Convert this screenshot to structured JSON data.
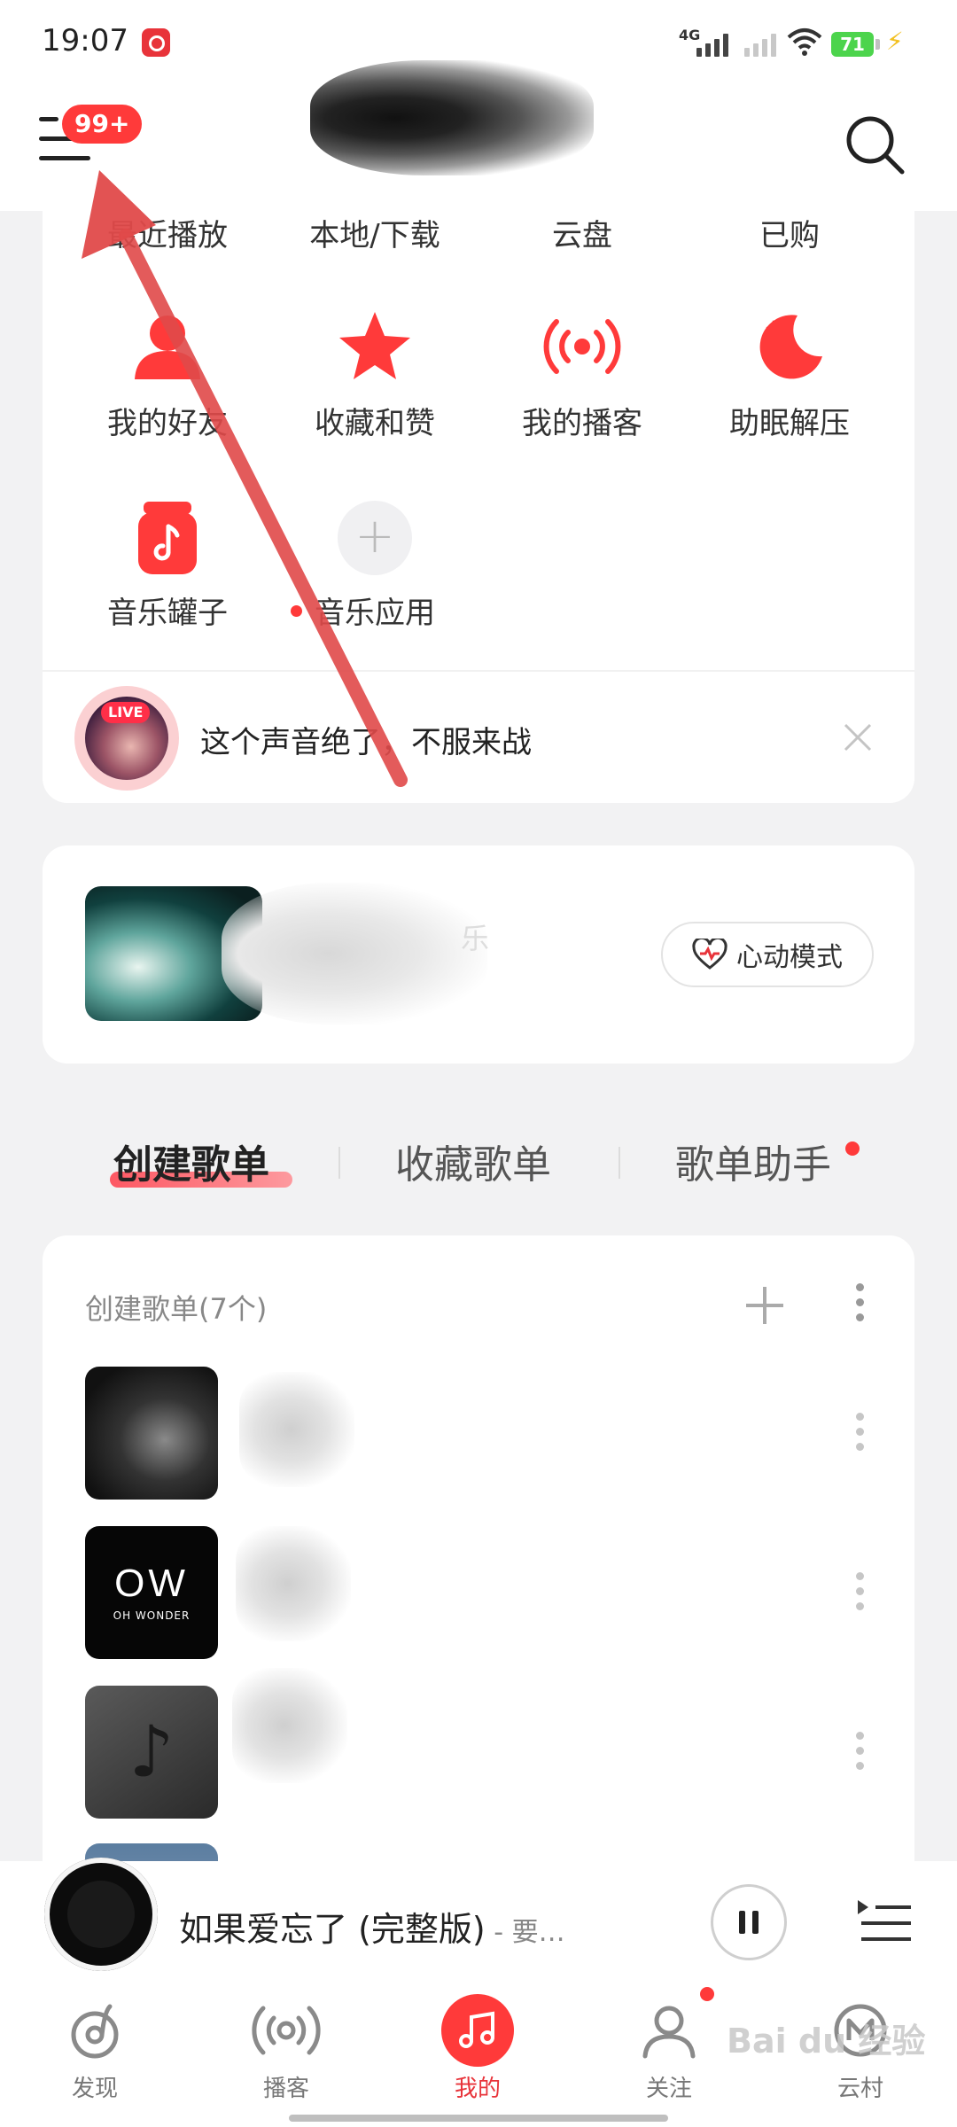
{
  "status_bar": {
    "time": "19:07",
    "network": "4G",
    "battery": "71"
  },
  "header": {
    "notification_badge": "99+"
  },
  "quick_grid": {
    "row1": [
      "最近播放",
      "本地/下载",
      "云盘",
      "已购"
    ],
    "row2": [
      "我的好友",
      "收藏和赞",
      "我的播客",
      "助眠解压"
    ],
    "row3": [
      "音乐罐子",
      "音乐应用"
    ]
  },
  "live_banner": {
    "tag": "LIVE",
    "text": "这个声音绝了，不服来战"
  },
  "heart_card": {
    "blurred_text": "乐",
    "mode_button": "心动模式"
  },
  "playlist_tabs": [
    "创建歌单",
    "收藏歌单",
    "歌单助手"
  ],
  "playlists": {
    "section_title": "创建歌单(7个)",
    "cover2_title": "OW",
    "cover2_subtitle": "OH WONDER",
    "cover3_glyph": "♪"
  },
  "player": {
    "song": "如果爱忘了 (完整版)",
    "separator": " - ",
    "artist": "要…"
  },
  "bottom_nav": [
    "发现",
    "播客",
    "我的",
    "关注",
    "云村"
  ],
  "watermark": "Bai du 经验",
  "colors": {
    "brand_red": "#e8333a",
    "badge_red": "#ff3a3a",
    "annotation_arrow": "#e04a4a"
  }
}
